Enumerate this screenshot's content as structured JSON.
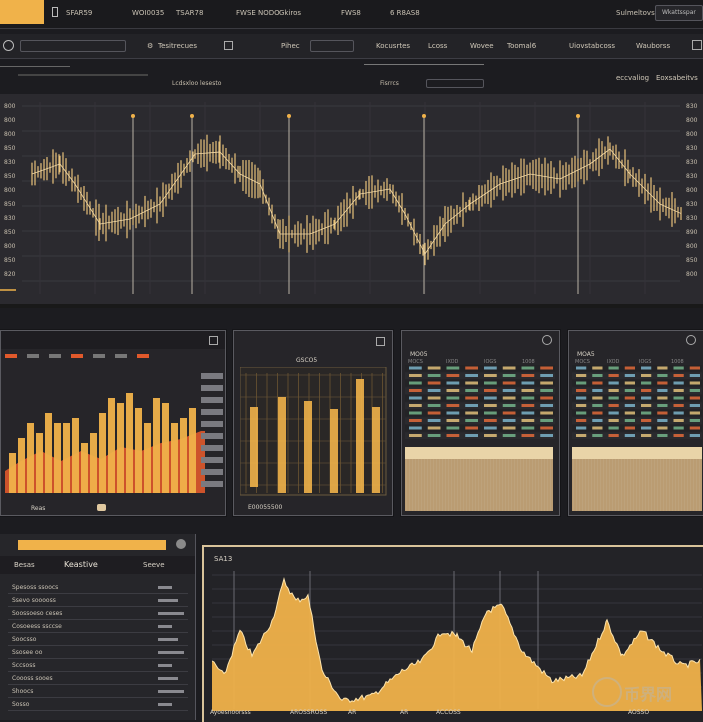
{
  "topbar": {
    "items": [
      "SFAR59",
      "WOI0035",
      "TSAR78",
      "FWSE NODO",
      "Gkiros",
      "FWS8",
      "6 R8AS8"
    ],
    "account": "Sulmeltovs",
    "search": "Wkattsspar"
  },
  "toolbar": {
    "items": [
      "Tesitrecues",
      "Pihec",
      "Kocusrtes",
      "Lcoss",
      "Wovee",
      "Toomal6",
      "Uiovstabcoss",
      "Wauborss"
    ]
  },
  "chart_header": {
    "label": "Lcdsxloo lesesto",
    "mid": "Fisrrcs",
    "right_a": "eccvaliog",
    "right_b": "Eoxsabeitvs"
  },
  "main_chart": {
    "type": "line",
    "y_tick_labels": [
      "800",
      "800",
      "800",
      "850",
      "830",
      "850",
      "800",
      "850",
      "830",
      "850",
      "800",
      "850",
      "820"
    ],
    "right_tick_labels": [
      "830",
      "800",
      "800",
      "830",
      "830",
      "830",
      "800",
      "830",
      "830",
      "890",
      "800",
      "850",
      "800"
    ]
  },
  "mini_panels": {
    "bar_panel": {
      "footer": "Reas"
    },
    "candle_panel": {
      "title": "GSCO5",
      "footer": "E00055500"
    },
    "table_panel_a": {
      "title": "MO05",
      "headers": [
        "MOCS",
        "IXOD",
        "IOGS",
        "1008"
      ]
    },
    "table_panel_b": {
      "title": "MOA5",
      "headers": [
        "MOCS",
        "IXOD",
        "IOGS",
        "1008"
      ]
    }
  },
  "order_panel": {
    "title": "Keastive",
    "subtitle": "Besas",
    "right": "Seeve",
    "rows": [
      "Spesoss ssoocs",
      "Ssevo sooooss",
      "Soossoeso ceses",
      "Cosoeess ssccse",
      "Soocsso",
      "Ssosee oo",
      "Sccsoss",
      "Coooss sooes",
      "Shoocs",
      "Sosso"
    ]
  },
  "bottom_chart": {
    "title": "SA13",
    "x_labels": [
      "Ayoesnoorsss",
      "AROSSROSS",
      "AR",
      "AR",
      "ACCOSS"
    ],
    "footer": "AOSSO"
  },
  "watermark": "币界网",
  "colors": {
    "accent": "#f0b24a",
    "red": "#e0592b",
    "bg": "#1c1c20"
  }
}
